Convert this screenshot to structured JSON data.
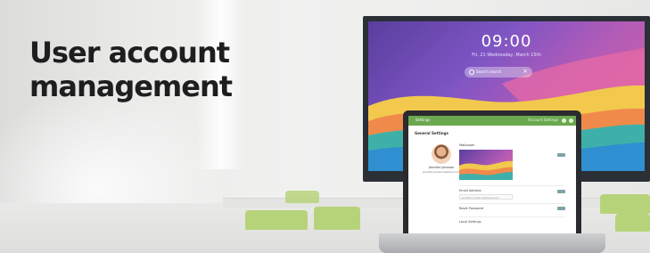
{
  "heading": {
    "line1": "User account",
    "line2": "management"
  },
  "display": {
    "clock": "09:00",
    "date": "Fri, 21 Wednesday, March 15th",
    "search_placeholder": "Search search"
  },
  "laptop": {
    "app_name": "Settings",
    "account_label": "Account Settings",
    "section_title": "General Settings",
    "user_name": "Jennifer Johnson",
    "user_email": "jennifer.johnson@benq.com",
    "wallpaper_label": "Wallpaper",
    "email_label": "Email Address",
    "email_value": "Jennifer.johnson@benq.com",
    "password_label": "Reset Password",
    "language_label": "Local Settings"
  },
  "colors": {
    "app_green": "#6aa84f",
    "chair_green": "#b7d37a",
    "heading": "#1e1e1e"
  }
}
